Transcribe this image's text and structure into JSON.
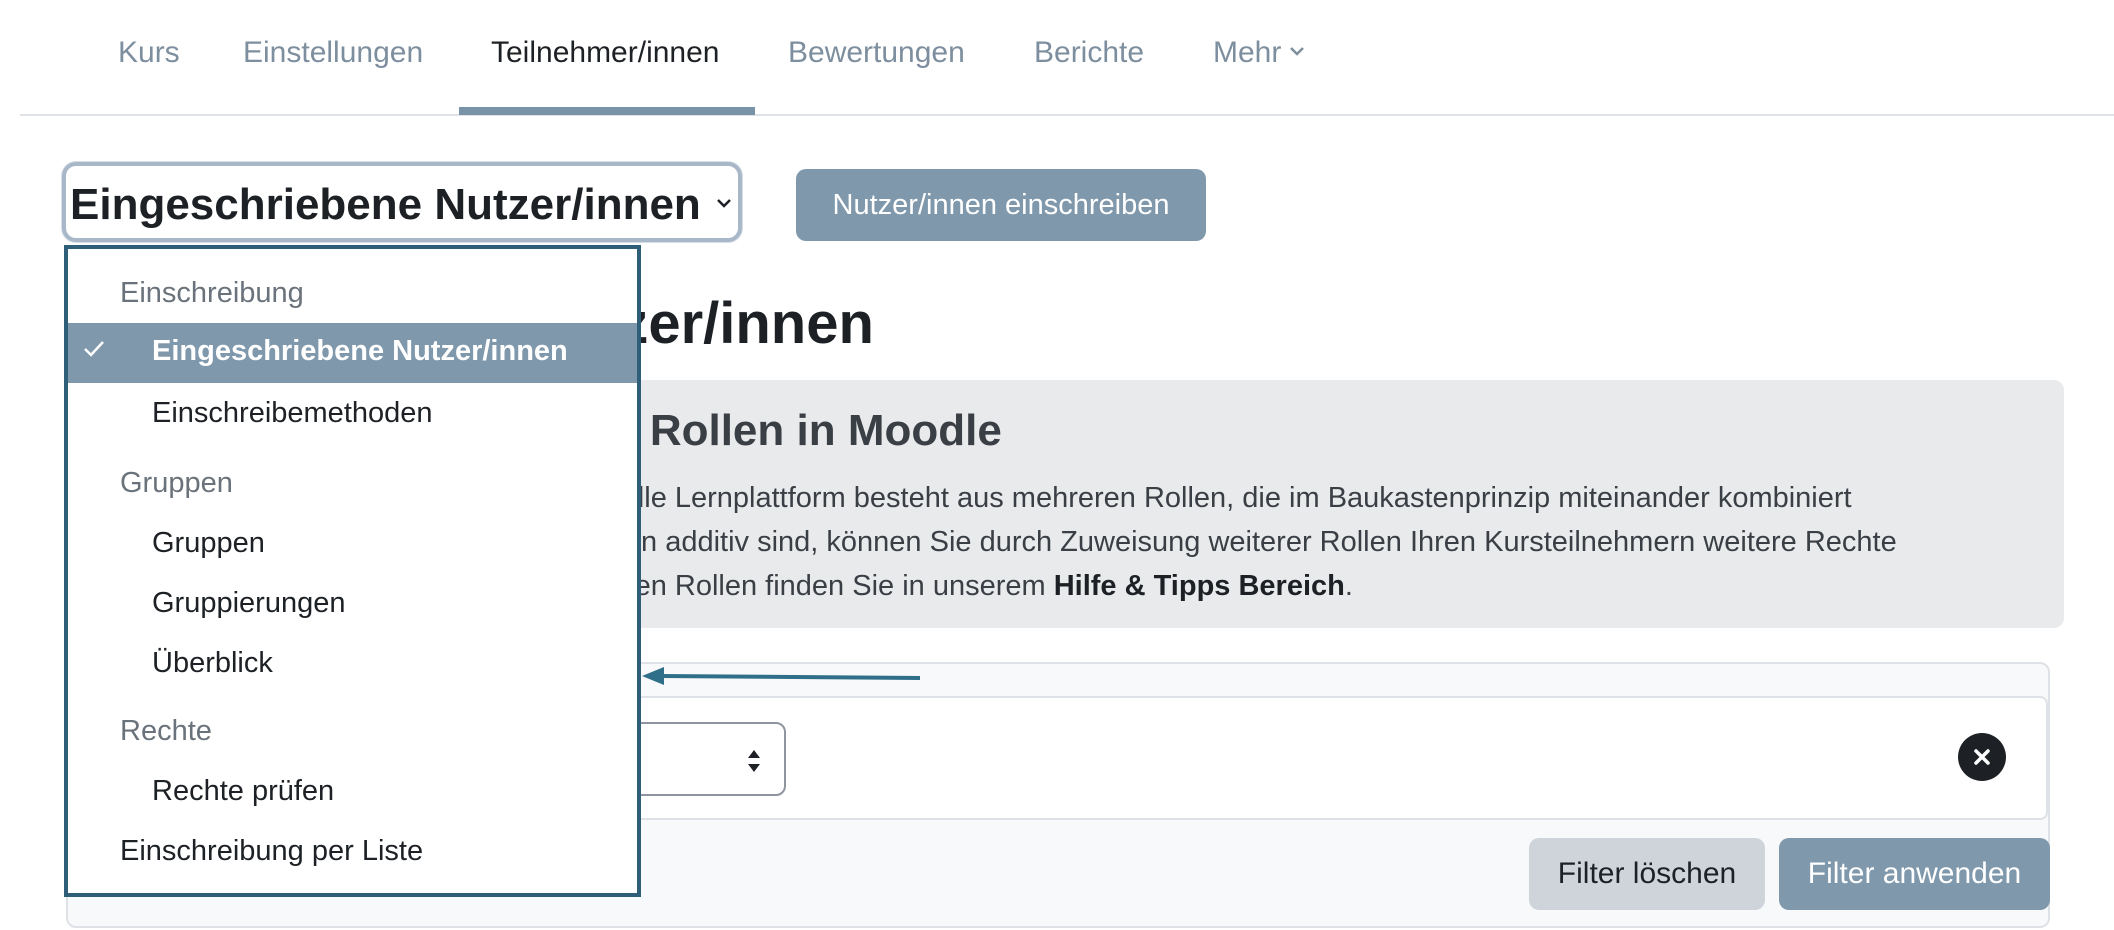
{
  "nav": {
    "tabs": [
      {
        "label": "Kurs"
      },
      {
        "label": "Einstellungen"
      },
      {
        "label": "Teilnehmer/innen"
      },
      {
        "label": "Bewertungen"
      },
      {
        "label": "Berichte"
      },
      {
        "label": "Mehr"
      }
    ],
    "active_tab": "Teilnehmer/innen"
  },
  "tertiary": {
    "selected": "Eingeschriebene Nutzer/innen",
    "enrol_button": "Nutzer/innen einschreiben"
  },
  "page": {
    "title_visible": "tzer/innen"
  },
  "info": {
    "heading_visible": "er Rollen in Moodle",
    "line1": "odle Lernplattform besteht aus mehreren Rollen, die im Baukastenprinzip miteinander kombiniert",
    "line2": "llen additiv sind, können Sie durch Zuweisung weiterer Rollen Ihren Kursteilnehmern weitere Rechte",
    "line3_prefix": "lnen Rollen finden Sie in unserem ",
    "line3_bold": "Hilfe & Tipps Bereich",
    "line3_suffix": "."
  },
  "filters": {
    "clear_label": "Filter löschen",
    "apply_label": "Filter anwenden"
  },
  "dropdown": {
    "header_enrol": "Einschreibung",
    "item_enrolled": "Eingeschriebene Nutzer/innen",
    "item_methods": "Einschreibemethoden",
    "header_groups": "Gruppen",
    "item_groups": "Gruppen",
    "item_groupings": "Gruppierungen",
    "item_overview": "Überblick",
    "header_rights": "Rechte",
    "item_check_rights": "Rechte prüfen",
    "item_bulk_enrol": "Einschreibung per Liste"
  },
  "colors": {
    "accent": "#7f98ac",
    "dropdown_border": "#2f5f78",
    "annotation_arrow": "#2f6f8a"
  },
  "icons": {
    "more_chevron": "chevron-down-icon",
    "select_caret": "chevron-down-icon",
    "check": "check-icon",
    "sort": "sort-updown-icon",
    "close": "close-icon"
  }
}
